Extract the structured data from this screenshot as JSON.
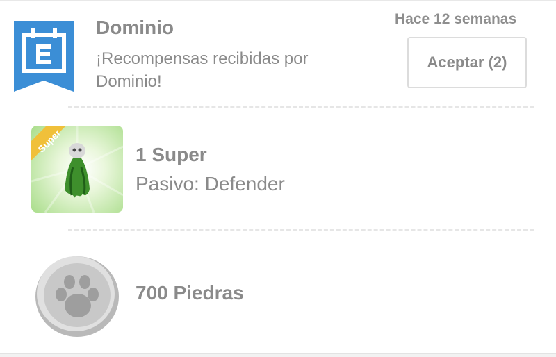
{
  "notification": {
    "title": "Dominio",
    "message": "¡Recompensas recibidas por Dominio!",
    "time_ago": "Hace 12 semanas",
    "accept_label": "Aceptar (2)",
    "icon": "calendar-ribbon-icon",
    "accent_color": "#3b8ed6"
  },
  "rewards": [
    {
      "title": "1 Super",
      "subtitle": "Pasivo: Defender",
      "badge": "Super",
      "icon": "super-card-icon"
    },
    {
      "title": "700 Piedras",
      "icon": "paw-stone-icon"
    }
  ]
}
